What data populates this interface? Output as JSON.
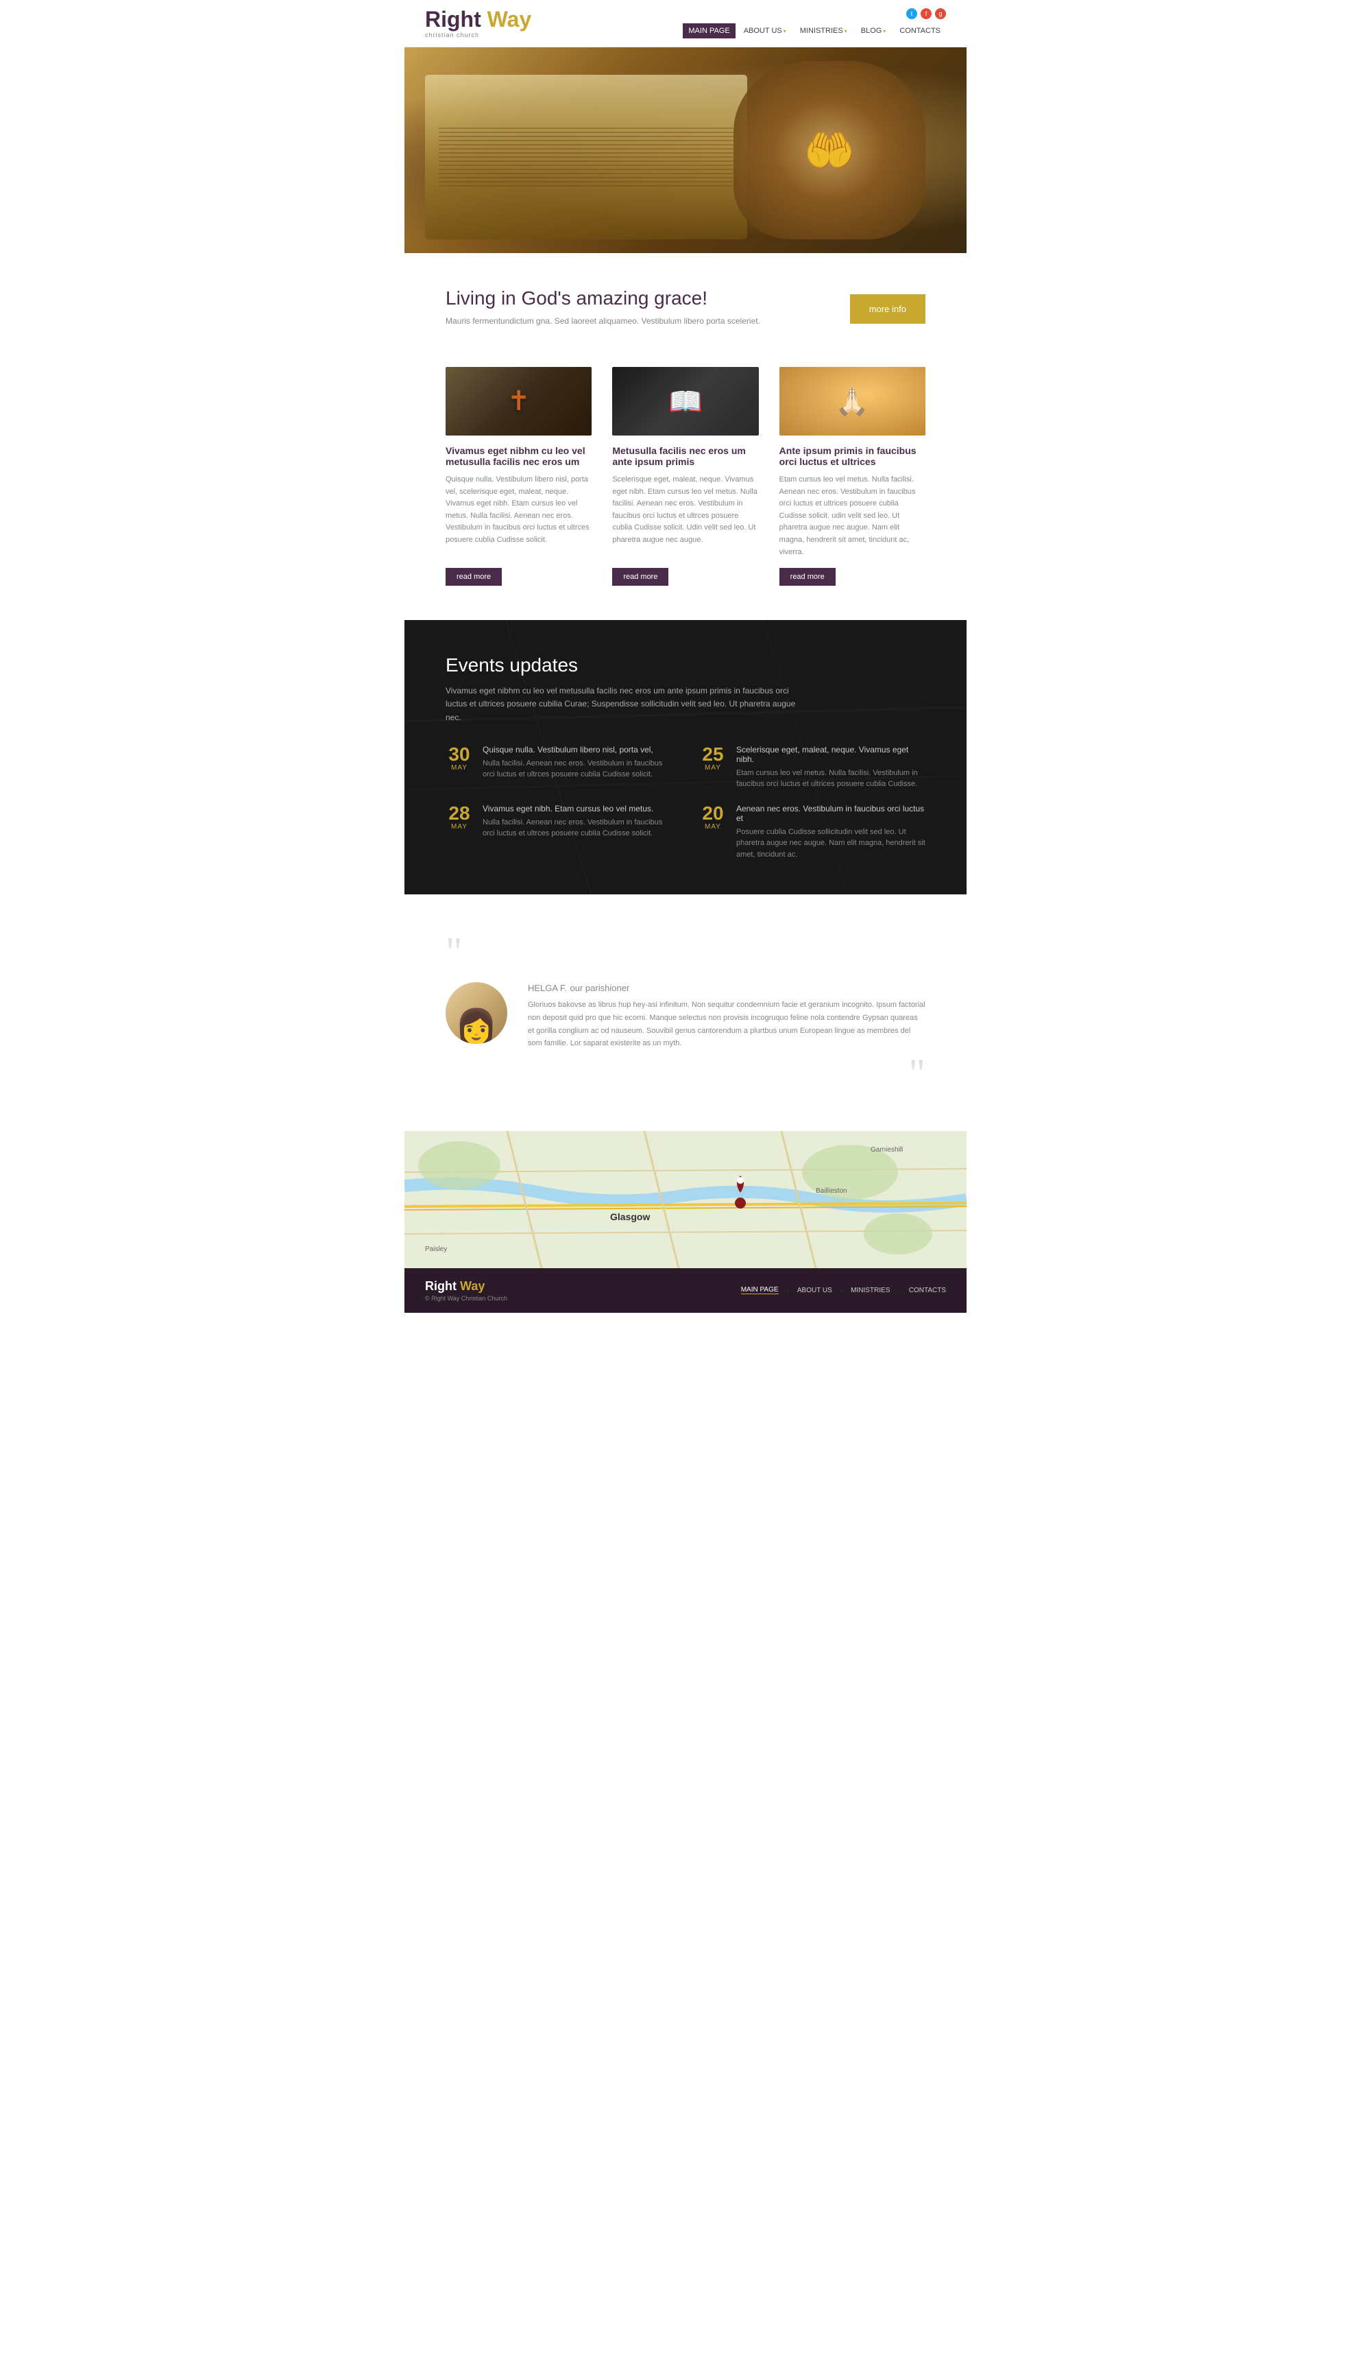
{
  "site": {
    "name_part1": "Right",
    "name_part2": "Way",
    "tagline": "christian church"
  },
  "header": {
    "nav": [
      {
        "label": "MAIN PAGE",
        "active": true,
        "has_dropdown": false
      },
      {
        "label": "ABOUT US",
        "active": false,
        "has_dropdown": true
      },
      {
        "label": "MINISTRIES",
        "active": false,
        "has_dropdown": true
      },
      {
        "label": "BLOG",
        "active": false,
        "has_dropdown": true
      },
      {
        "label": "CONTACTS",
        "active": false,
        "has_dropdown": false
      }
    ],
    "social": [
      "twitter",
      "facebook",
      "gplus"
    ]
  },
  "hero": {
    "alt": "Praying hands over Bible"
  },
  "intro": {
    "heading": "Living in God's amazing grace!",
    "description": "Mauris fermentundictum gna. Sed laoreet aliquameo. Vestibulum libero porta sceleriet.",
    "button_label": "more info"
  },
  "cards": [
    {
      "title": "Vivamus eget nibhm cu leo vel metusulla facilis nec eros um",
      "body": "Quisque nulla. Vestibulum libero nisl, porta vel, scelerisque eget, maleat, neque. Vivamus eget nibh. Etam cursus leo vel metus. Nulla facilisi. Aenean nec eros. Vestibulum in faucibus orci luctus et ultrces posuere cublia Cudisse solicit.",
      "button": "read more",
      "img_type": "cross"
    },
    {
      "title": "Metusulla facilis nec eros um ante ipsum primis",
      "body": "Scelerisque eget, maleat, neque. Vivamus eget nibh. Etam cursus leo vel metus. Nulla facilisi. Aenean nec eros. Vestibulum in faucibus orci luctus et ultrces posuere cublia Cudisse solicit. Udin velit sed leo. Ut pharetra augue nec augue.",
      "button": "read more",
      "img_type": "book"
    },
    {
      "title": "Ante ipsum primis in faucibus orci luctus et ultrices",
      "body": "Etam cursus leo vel metus. Nulla facilisi. Aenean nec eros. Vestibulum in faucibus orci luctus et ultrices posuere cublia Cudisse solicit. udin velit sed leo. Ut pharetra augue nec augue. Nam elit magna, hendrerit sit amet, tincidunt ac, viverra.",
      "button": "read more",
      "img_type": "pray"
    }
  ],
  "events": {
    "heading": "Events updates",
    "description": "Vivamus eget nibhm cu leo vel metusulla facilis nec eros um ante ipsum primis in faucibus orci luctus et ultrices posuere cubilia Curae; Suspendisse sollicitudin velit sed leo. Ut pharetra augue nec.",
    "items": [
      {
        "day": "30",
        "month": "MAY",
        "title": "Quisque nulla. Vestibulum libero nisl, porta vel,",
        "body": "Nulla facilisi. Aenean nec eros. Vestibulum in faucibus orci luctus et ultrces posuere cublia Cudisse solicit."
      },
      {
        "day": "25",
        "month": "MAY",
        "title": "Scelerisque eget, maleat, neque. Vivamus eget nibh.",
        "body": "Etam cursus leo vel metus. Nulla facilisi. Vestibulum in faucibus orci luctus et ultrices posuere cublia Cudisse."
      },
      {
        "day": "28",
        "month": "MAY",
        "title": "Vivamus eget nibh. Etam cursus leo vel metus.",
        "body": "Nulla facilisi. Aenean nec eros. Vestibulum in faucibus orci luctus et ultrces posuere cublia Cudisse solicit."
      },
      {
        "day": "20",
        "month": "MAY",
        "title": "Aenean nec eros. Vestibulum in faucibus orci luctus et",
        "body": "Posuere cublia Cudisse sollicitudin velit sed leo. Ut pharetra augue nec augue. Nam elit magna, hendrerit sit amet, tincidunt ac."
      }
    ]
  },
  "testimonial": {
    "name": "HELGA F.",
    "role": "our parishioner",
    "text": "Gloriuos bakovse as librus hup hey-asi infinitum. Non sequitur condemnium facie et geranium incognito. Ipsum factorial non deposit quid pro que hic ecorni. Manque selectus non provisis incogruquo feline nola contendre Gypsan quareas et gorilla conglium ac od nauseum. Souvibil genus cantorendum a plurtbus unum European lingue as membres del som familie. Lor saparat existerite as un myth."
  },
  "footer": {
    "name_part1": "Right",
    "name_part2": "Way",
    "copyright": "© Right Way Christian Church",
    "nav": [
      {
        "label": "MAIN PAGE",
        "active": true
      },
      {
        "label": "ABOUT US",
        "active": false
      },
      {
        "label": "MINISTRIES",
        "active": false
      },
      {
        "label": "CONTACTS",
        "active": false
      }
    ]
  }
}
